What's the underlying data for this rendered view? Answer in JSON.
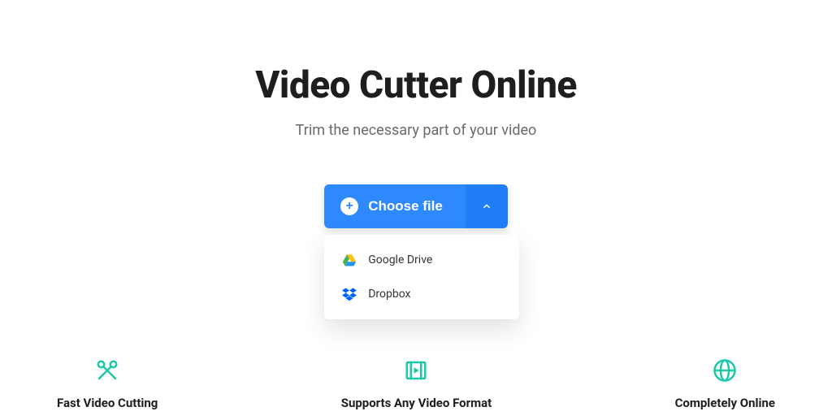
{
  "hero": {
    "title": "Video Cutter Online",
    "subtitle": "Trim the necessary part of your video"
  },
  "chooser": {
    "button_label": "Choose file",
    "options": [
      {
        "label": "Google Drive",
        "icon": "google-drive-icon"
      },
      {
        "label": "Dropbox",
        "icon": "dropbox-icon"
      }
    ]
  },
  "features": [
    {
      "label": "Fast Video Cutting",
      "icon": "scissors-icon"
    },
    {
      "label": "Supports Any Video Format",
      "icon": "video-format-icon"
    },
    {
      "label": "Completely Online",
      "icon": "globe-icon"
    }
  ],
  "colors": {
    "primary": "#2e89ff",
    "accent": "#1cc9a8"
  }
}
